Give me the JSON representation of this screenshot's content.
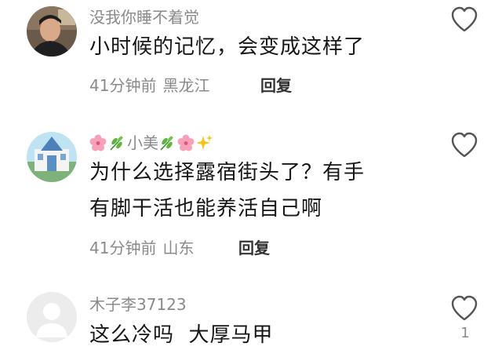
{
  "comments": [
    {
      "username": "没我你睡不着觉",
      "text_lines": [
        "小时候的记忆，会变成这样了"
      ],
      "time": "41分钟前",
      "location": "黑龙江",
      "reply_label": "回复",
      "like_count": ""
    },
    {
      "username_prefix_emojis": [
        "cherry-blossom-icon",
        "herb-icon"
      ],
      "username": "小美",
      "username_suffix_emojis": [
        "herb-icon",
        "cherry-blossom-icon",
        "sparkles-icon"
      ],
      "text_lines": [
        "为什么选择露宿街头了？有手",
        "有脚干活也能养活自己啊"
      ],
      "time": "41分钟前",
      "location": "山东",
      "reply_label": "回复",
      "like_count": ""
    },
    {
      "username": "木子李37123",
      "text_lines": [
        "这么冷吗  大厚马甲"
      ],
      "like_count": "1"
    }
  ]
}
